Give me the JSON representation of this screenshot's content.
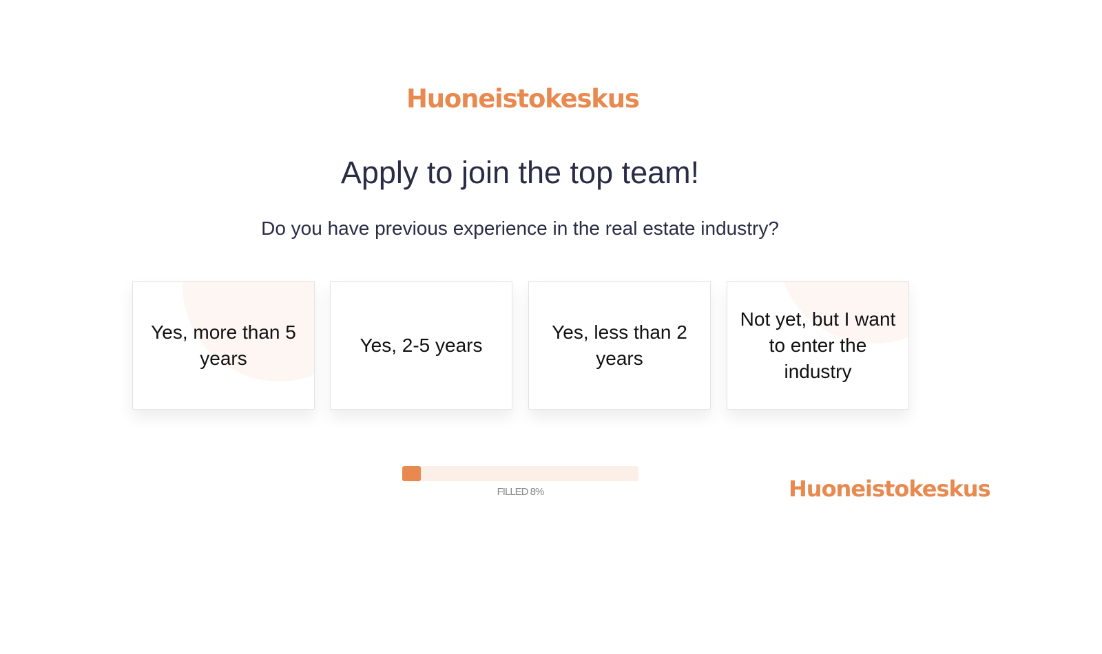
{
  "brand": {
    "name": "Huoneistokeskus",
    "color": "#e8894f"
  },
  "header": {
    "title": "Apply to join the top team!"
  },
  "question": {
    "text": "Do you have previous experience in the real estate industry?",
    "options": [
      {
        "label": "Yes, more than 5 years"
      },
      {
        "label": "Yes, 2-5 years"
      },
      {
        "label": "Yes, less than 2 years"
      },
      {
        "label": "Not yet, but I want to enter the industry"
      }
    ]
  },
  "progress": {
    "percent": 8,
    "label": "FILLED 8%"
  },
  "footer": {
    "logo_text": "Huoneistokeskus"
  },
  "colors": {
    "text_dark": "#2b2b45",
    "progress_track": "#fcefe8",
    "decor_circle": "#fdf6f2"
  }
}
